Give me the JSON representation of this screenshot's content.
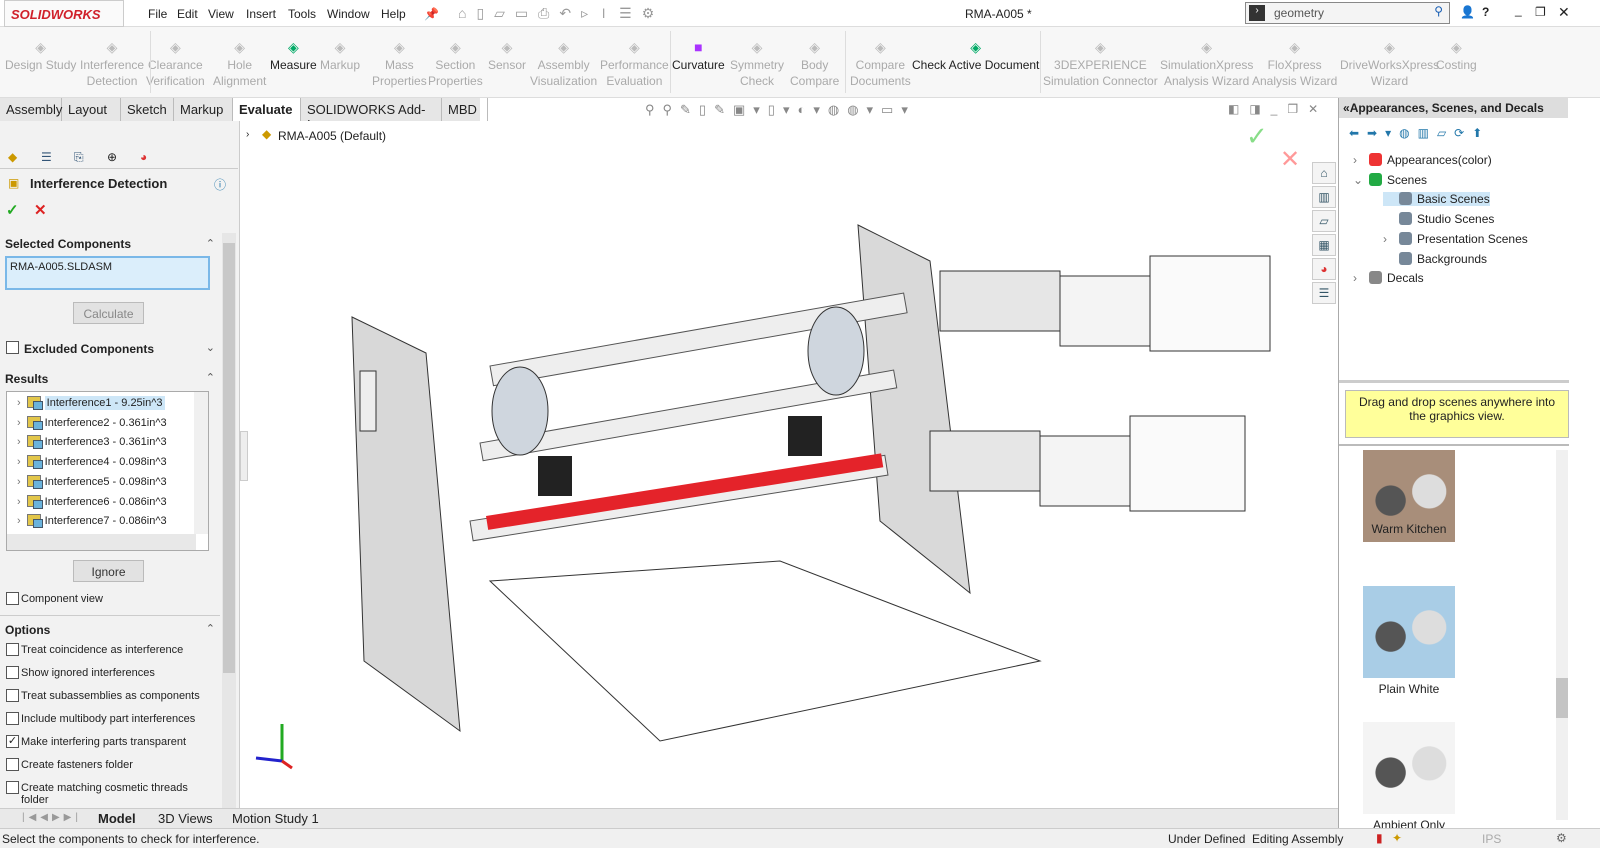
{
  "app": {
    "logo": "SOLIDWORKS",
    "doc_title": "RMA-A005 *"
  },
  "menu": [
    "File",
    "Edit",
    "View",
    "Insert",
    "Tools",
    "Window",
    "Help"
  ],
  "search": {
    "value": "geometry"
  },
  "toolbar": [
    {
      "l1": "Design Study",
      "l2": "",
      "on": false
    },
    {
      "l1": "Interference",
      "l2": "Detection",
      "on": false
    },
    {
      "l1": "Clearance",
      "l2": "Verification",
      "on": false
    },
    {
      "l1": "Hole",
      "l2": "Alignment",
      "on": false
    },
    {
      "l1": "Measure",
      "l2": "",
      "on": true
    },
    {
      "l1": "Markup",
      "l2": "",
      "on": false
    },
    {
      "l1": "Mass",
      "l2": "Properties",
      "on": false
    },
    {
      "l1": "Section",
      "l2": "Properties",
      "on": false
    },
    {
      "l1": "Sensor",
      "l2": "",
      "on": false
    },
    {
      "l1": "Assembly",
      "l2": "Visualization",
      "on": false
    },
    {
      "l1": "Performance",
      "l2": "Evaluation",
      "on": false
    },
    {
      "l1": "Curvature",
      "l2": "",
      "on": true
    },
    {
      "l1": "Symmetry",
      "l2": "Check",
      "on": false
    },
    {
      "l1": "Body",
      "l2": "Compare",
      "on": false
    },
    {
      "l1": "Compare",
      "l2": "Documents",
      "on": false
    },
    {
      "l1": "Check Active Document",
      "l2": "",
      "on": true
    },
    {
      "l1": "3DEXPERIENCE",
      "l2": "Simulation Connector",
      "on": false
    },
    {
      "l1": "SimulationXpress",
      "l2": "Analysis Wizard",
      "on": false
    },
    {
      "l1": "FloXpress",
      "l2": "Analysis Wizard",
      "on": false
    },
    {
      "l1": "DriveWorksXpress",
      "l2": "Wizard",
      "on": false
    },
    {
      "l1": "Costing",
      "l2": "",
      "on": false
    }
  ],
  "tabs": [
    "Assembly",
    "Layout",
    "Sketch",
    "Markup",
    "Evaluate",
    "SOLIDWORKS Add-Ins",
    "MBD"
  ],
  "panel": {
    "title": "Interference Detection",
    "selected_components_label": "Selected Components",
    "selected_component": "RMA-A005.SLDASM",
    "calculate": "Calculate",
    "excluded_components": "Excluded Components",
    "results_label": "Results",
    "results": [
      "Interference1 - 9.25in^3",
      "Interference2 - 0.361in^3",
      "Interference3 - 0.361in^3",
      "Interference4 - 0.098in^3",
      "Interference5 - 0.098in^3",
      "Interference6 - 0.086in^3",
      "Interference7 - 0.086in^3"
    ],
    "ignore": "Ignore",
    "component_view": "Component view",
    "options_label": "Options",
    "options": [
      {
        "label": "Treat coincidence as interference",
        "checked": false
      },
      {
        "label": "Show ignored interferences",
        "checked": false
      },
      {
        "label": "Treat subassemblies as components",
        "checked": false
      },
      {
        "label": "Include multibody part interferences",
        "checked": false
      },
      {
        "label": "Make interfering parts transparent",
        "checked": true
      },
      {
        "label": "Create fasteners folder",
        "checked": false
      },
      {
        "label": "Create matching cosmetic threads folder",
        "checked": false
      }
    ]
  },
  "viewport": {
    "tree_root": "RMA-A005  (Default)"
  },
  "taskpane": {
    "title": "Appearances, Scenes, and Decals",
    "tree": [
      "Appearances(color)",
      "Scenes",
      "Basic Scenes",
      "Studio Scenes",
      "Presentation Scenes",
      "Backgrounds",
      "Decals"
    ],
    "hint": "Drag and drop scenes anywhere into the graphics view.",
    "scenes": [
      "Warm Kitchen",
      "Plain White",
      "Ambient Only"
    ]
  },
  "bottom_tabs": [
    "Model",
    "3D Views",
    "Motion Study 1"
  ],
  "status": {
    "message": "Select the components to check for interference.",
    "state": "Under Defined",
    "mode": "Editing Assembly",
    "units": "IPS"
  }
}
